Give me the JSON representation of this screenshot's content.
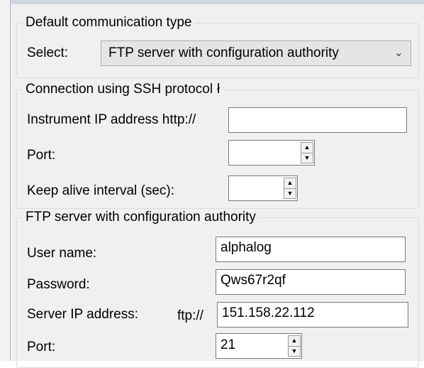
{
  "default_comm": {
    "title": "Default communication type",
    "select_label": "Select:",
    "selected": "FTP server with configuration authority"
  },
  "ssh": {
    "title": "Connection using SSH protocol",
    "ip_label": "Instrument IP address http://",
    "ip_value": "",
    "port_label": "Port:",
    "port_value": "",
    "keepalive_label": "Keep alive interval (sec):",
    "keepalive_value": ""
  },
  "ftp": {
    "title": "FTP server with configuration authority",
    "user_label": "User name:",
    "user_value": "alphalog",
    "password_label": "Password:",
    "password_value": "Qws67r2qf",
    "server_label": "Server IP address:",
    "server_prefix": "ftp://",
    "server_value": "151.158.22.112",
    "port_label": "Port:",
    "port_value": "21"
  },
  "icons": [
    "chevron-down-icon",
    "spin-up-icon",
    "spin-down-icon"
  ]
}
